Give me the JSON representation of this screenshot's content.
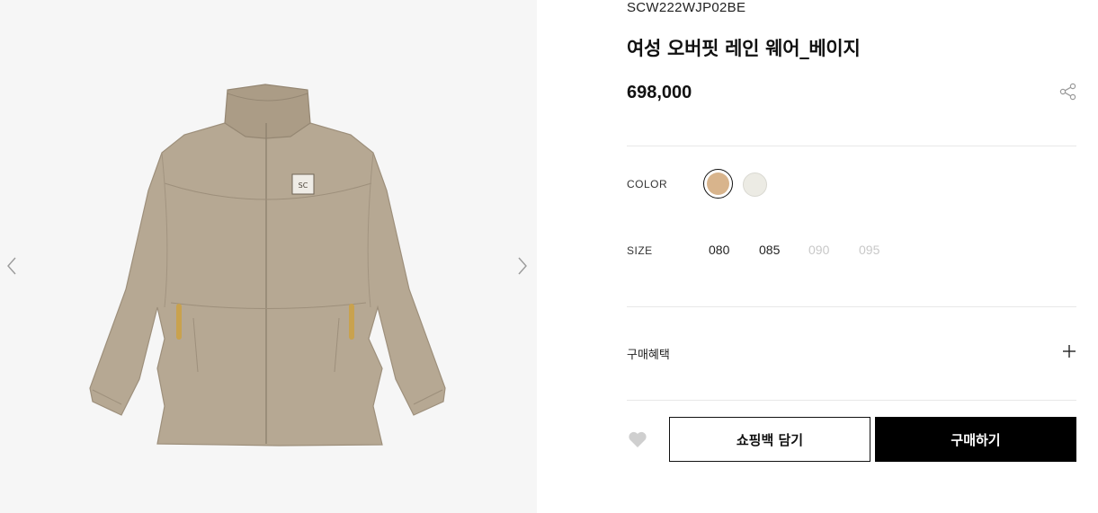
{
  "product": {
    "sku": "SCW222WJP02BE",
    "title": "여성 오버핏 레인 웨어_베이지",
    "price": "698,000"
  },
  "colors": {
    "label": "COLOR",
    "options": [
      {
        "name": "beige",
        "hex": "#d8b48c",
        "selected": true
      },
      {
        "name": "ivory",
        "hex": "#ecebe4",
        "selected": false
      }
    ]
  },
  "sizes": {
    "label": "SIZE",
    "options": [
      {
        "label": "080",
        "available": true
      },
      {
        "label": "085",
        "available": true
      },
      {
        "label": "090",
        "available": false
      },
      {
        "label": "095",
        "available": false
      }
    ]
  },
  "benefit": {
    "label": "구매혜택"
  },
  "actions": {
    "cart_label": "쇼핑백 담기",
    "buy_label": "구매하기"
  },
  "icons": {
    "prev": "chevron-left-icon",
    "next": "chevron-right-icon",
    "share": "share-icon",
    "plus": "plus-icon",
    "wishlist": "heart-icon"
  },
  "theme": {
    "jacket_color": "#b6a893",
    "accent": "#000000"
  }
}
